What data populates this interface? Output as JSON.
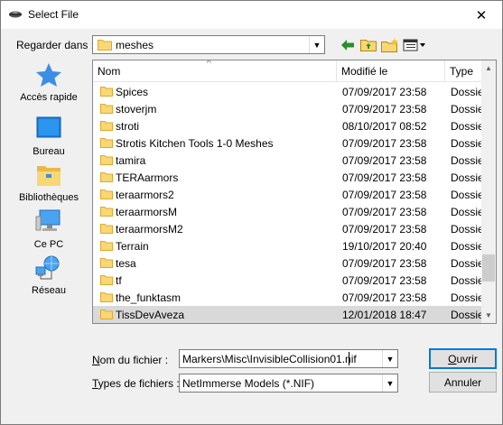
{
  "window": {
    "title": "Select File",
    "close_glyph": "✕"
  },
  "lookin": {
    "label": "Regarder dans :",
    "value": "meshes"
  },
  "toolbar": {
    "icons": [
      "back-icon",
      "up-folder-icon",
      "new-folder-icon",
      "view-menu-icon"
    ]
  },
  "places": [
    {
      "label": "Accès rapide",
      "icon": "quick-access-star-icon"
    },
    {
      "label": "Bureau",
      "icon": "desktop-icon"
    },
    {
      "label": "Bibliothèques",
      "icon": "libraries-icon"
    },
    {
      "label": "Ce PC",
      "icon": "computer-icon"
    },
    {
      "label": "Réseau",
      "icon": "network-icon"
    }
  ],
  "columns": {
    "name": "Nom",
    "modified": "Modifié le",
    "type": "Type"
  },
  "files": [
    {
      "name": "Spices",
      "modified": "07/09/2017 23:58",
      "type": "Dossie"
    },
    {
      "name": "stoverjm",
      "modified": "07/09/2017 23:58",
      "type": "Dossie"
    },
    {
      "name": "stroti",
      "modified": "08/10/2017 08:52",
      "type": "Dossie"
    },
    {
      "name": "Strotis Kitchen Tools 1-0 Meshes",
      "modified": "07/09/2017 23:58",
      "type": "Dossie"
    },
    {
      "name": "tamira",
      "modified": "07/09/2017 23:58",
      "type": "Dossie"
    },
    {
      "name": "TERAarmors",
      "modified": "07/09/2017 23:58",
      "type": "Dossie"
    },
    {
      "name": "teraarmors2",
      "modified": "07/09/2017 23:58",
      "type": "Dossie"
    },
    {
      "name": "teraarmorsM",
      "modified": "07/09/2017 23:58",
      "type": "Dossie"
    },
    {
      "name": "teraarmorsM2",
      "modified": "07/09/2017 23:58",
      "type": "Dossie"
    },
    {
      "name": "Terrain",
      "modified": "19/10/2017 20:40",
      "type": "Dossie"
    },
    {
      "name": "tesa",
      "modified": "07/09/2017 23:58",
      "type": "Dossie"
    },
    {
      "name": "tf",
      "modified": "07/09/2017 23:58",
      "type": "Dossie"
    },
    {
      "name": "the_funktasm",
      "modified": "07/09/2017 23:58",
      "type": "Dossie"
    },
    {
      "name": "TissDevAveza",
      "modified": "12/01/2018 18:47",
      "type": "Dossie"
    }
  ],
  "selected_file": "TissDevAveza",
  "filename": {
    "label_u": "N",
    "label_rest": "om du fichier :",
    "value": "Markers\\Misc\\InvisibleCollision01.nif"
  },
  "filetype": {
    "label_u": "T",
    "label_rest": "ypes de fichiers :",
    "value": "NetImmerse Models (*.NIF)"
  },
  "buttons": {
    "open_u": "O",
    "open_rest": "uvrir",
    "cancel": "Annuler"
  },
  "colors": {
    "folder": "#f8d775",
    "folder_dark": "#e0a82e",
    "accent": "#0078d7",
    "selected_row": "#d9d9d9"
  }
}
